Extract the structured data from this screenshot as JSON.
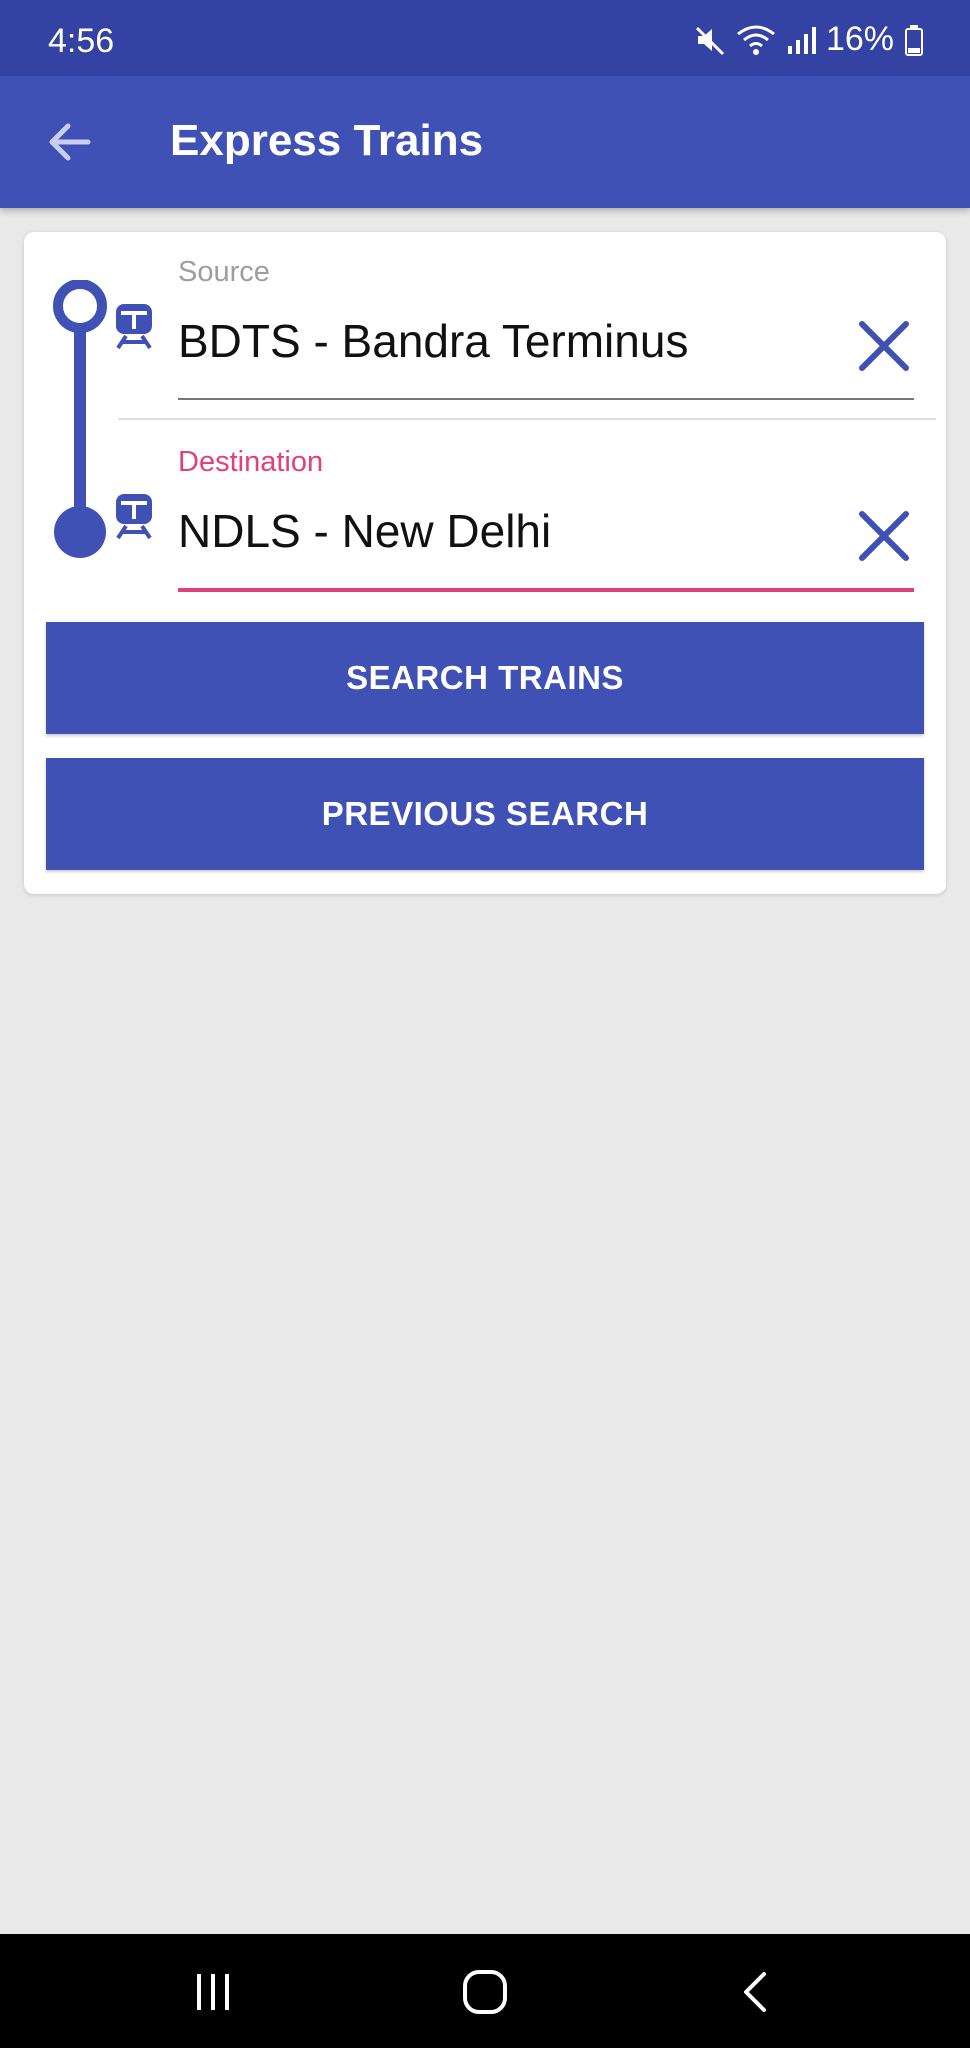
{
  "status_bar": {
    "time": "4:56",
    "battery": "16%",
    "icons": [
      "mute-icon",
      "wifi-icon",
      "signal-icon",
      "battery-icon"
    ]
  },
  "app_bar": {
    "title": "Express Trains",
    "back_icon": "arrow-back-icon"
  },
  "search_form": {
    "source": {
      "label": "Source",
      "value": "BDTS - Bandra Terminus"
    },
    "destination": {
      "label": "Destination",
      "value": "NDLS - New Delhi"
    },
    "search_button": "SEARCH TRAINS",
    "previous_button": "PREVIOUS SEARCH"
  },
  "colors": {
    "primary": "#3f51b5",
    "status_bar": "#3342a3",
    "accent": "#e2407a",
    "background": "#e9e9e9"
  },
  "nav_bar": {
    "icons": [
      "recent-apps-icon",
      "home-icon",
      "back-icon"
    ]
  }
}
